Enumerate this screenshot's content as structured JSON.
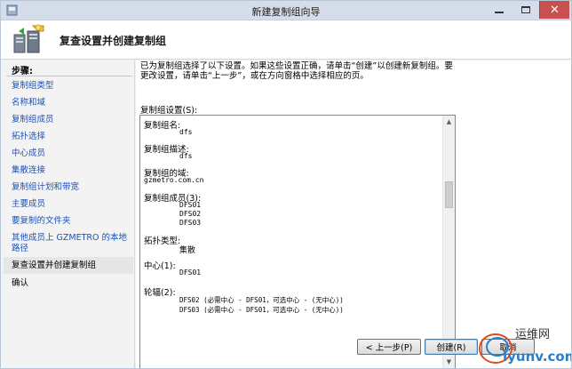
{
  "window": {
    "title": "新建复制组向导",
    "close_glyph": "✕"
  },
  "header": {
    "title": "复查设置并创建复制组",
    "icon": "replication-wizard-icon"
  },
  "sidebar": {
    "steps_title": "步骤:",
    "steps": [
      {
        "label": "复制组类型",
        "state": "link"
      },
      {
        "label": "名称和域",
        "state": "link"
      },
      {
        "label": "复制组成员",
        "state": "link"
      },
      {
        "label": "拓扑选择",
        "state": "link"
      },
      {
        "label": "中心成员",
        "state": "link"
      },
      {
        "label": "集散连接",
        "state": "link"
      },
      {
        "label": "复制组计划和带宽",
        "state": "link"
      },
      {
        "label": "主要成员",
        "state": "link"
      },
      {
        "label": "要复制的文件夹",
        "state": "link"
      },
      {
        "label": "其他成员上 GZMETRO 的本地路径",
        "state": "link"
      },
      {
        "label": "复查设置并创建复制组",
        "state": "current"
      },
      {
        "label": "确认",
        "state": "plain"
      }
    ]
  },
  "content": {
    "description": "已为复制组选择了以下设置。如果这些设置正确，请单击“创建”以创建新复制组。要更改设置，请单击“上一步”，或在方向窗格中选择相应的页。",
    "settings_label": "复制组设置(S):",
    "settings": {
      "name_label": "复制组名:",
      "name_value": "dfs",
      "desc_label": "复制组描述:",
      "desc_value": "dfs",
      "domain_label": "复制组的域:",
      "domain_value": "gzmetro.com.cn",
      "members_label": "复制组成员(3):",
      "members": [
        "DFS01",
        "DFS02",
        "DFS03"
      ],
      "topology_label": "拓扑类型:",
      "topology_value": "集散",
      "hub_label": "中心(1):",
      "hub_value": "DFS01",
      "spoke_label": "轮辐(2):",
      "spokes": [
        "DFS02 (必需中心 - DFS01，可选中心 - (无中心))",
        "DFS03 (必需中心 - DFS01，可选中心 - (无中心))"
      ]
    }
  },
  "buttons": {
    "back": "< 上一步(P)",
    "create": "创建(R)",
    "cancel": "取消"
  },
  "watermark": {
    "text_cn": "运维网",
    "text_url": "iyunv.com"
  },
  "colors": {
    "link": "#1d52b8",
    "close_button": "#c75050",
    "titlebar": "#d4dde9"
  }
}
